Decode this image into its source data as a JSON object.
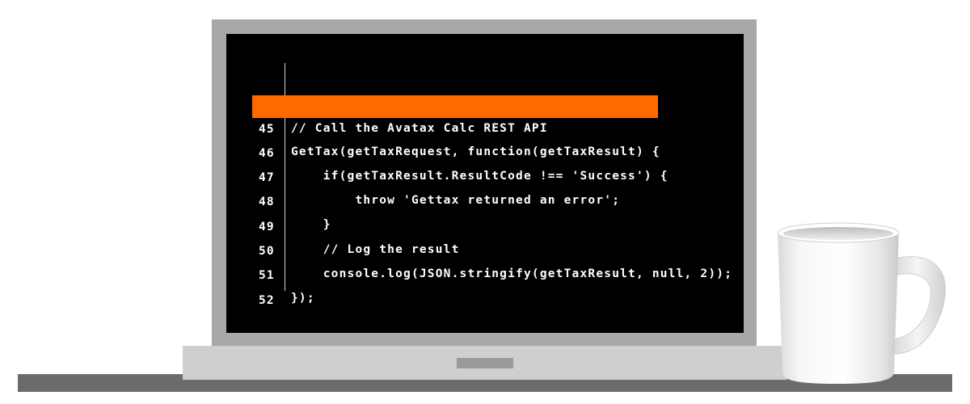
{
  "editor": {
    "lines": [
      {
        "num": "",
        "code": "// Call the Avatax Calc REST API",
        "highlighted": false
      },
      {
        "num": "45",
        "code": "GetTax(getTaxRequest, function(getTaxResult) {",
        "highlighted": true
      },
      {
        "num": "46",
        "code": "    if(getTaxResult.ResultCode !== 'Success') {",
        "highlighted": false
      },
      {
        "num": "47",
        "code": "        throw 'Gettax returned an error';",
        "highlighted": false
      },
      {
        "num": "48",
        "code": "    }",
        "highlighted": false
      },
      {
        "num": "49",
        "code": "    // Log the result",
        "highlighted": false
      },
      {
        "num": "50",
        "code": "    console.log(JSON.stringify(getTaxResult, null, 2));",
        "highlighted": false
      },
      {
        "num": "51",
        "code": "});",
        "highlighted": false
      },
      {
        "num": "52",
        "code": "",
        "highlighted": false
      }
    ]
  },
  "colors": {
    "highlight": "#ff6a00",
    "screen": "#000000",
    "laptop_frame": "#a8a8a8",
    "laptop_base": "#cfcfcf",
    "desk": "#6b6b6b",
    "mug": "#ffffff"
  },
  "icons": {
    "mug": "coffee-mug-icon",
    "laptop": "laptop-icon"
  }
}
